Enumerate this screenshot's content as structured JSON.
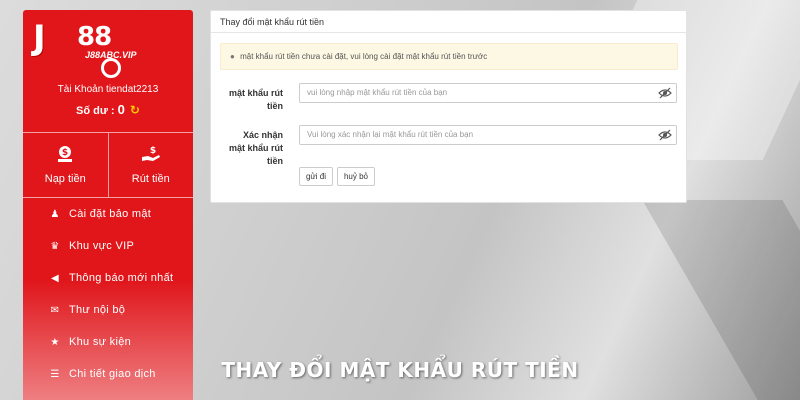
{
  "brand": {
    "logo_letter": "J",
    "logo_digits": "88",
    "logo_domain": "J88ABC.VIP"
  },
  "account": {
    "account_text": "Tài Khoản tiendat2213",
    "balance_label": "Số dư :",
    "balance_value": "0"
  },
  "actions": [
    {
      "label": "Nạp tiền",
      "icon": "deposit-icon"
    },
    {
      "label": "Rút tiền",
      "icon": "withdraw-icon"
    }
  ],
  "menu": [
    {
      "label": "Cài đặt bảo mật",
      "icon": "user-lock-icon"
    },
    {
      "label": "Khu vực VIP",
      "icon": "crown-icon"
    },
    {
      "label": "Thông báo mới nhất",
      "icon": "megaphone-icon"
    },
    {
      "label": "Thư nội bộ",
      "icon": "mail-icon"
    },
    {
      "label": "Khu sự kiện",
      "icon": "trophy-icon"
    },
    {
      "label": "Chi tiết giao dịch",
      "icon": "list-icon"
    }
  ],
  "card": {
    "title": "Thay đổi mật khẩu rút tiền",
    "alert": "mật khẩu rút tiền chưa cài đặt, vui lòng cài đặt mật khẩu rút tiền trước",
    "fields": [
      {
        "label": "mật khẩu rút tiền",
        "placeholder": "vui lòng nhập mật khẩu rút tiền của bạn"
      },
      {
        "label": "Xác nhận mật khẩu rút tiền",
        "placeholder": "Vui lòng xác nhận lại mật khẩu rút tiền của bạn"
      }
    ],
    "submit_label": "gửi đi",
    "cancel_label": "huỷ bỏ"
  },
  "caption": "THAY ĐỔI MẬT KHẨU RÚT TIỀN",
  "colors": {
    "sidebar_red": "#e0161b",
    "alert_bg": "#fcf8e3",
    "coin_yellow": "#ffcc00"
  }
}
